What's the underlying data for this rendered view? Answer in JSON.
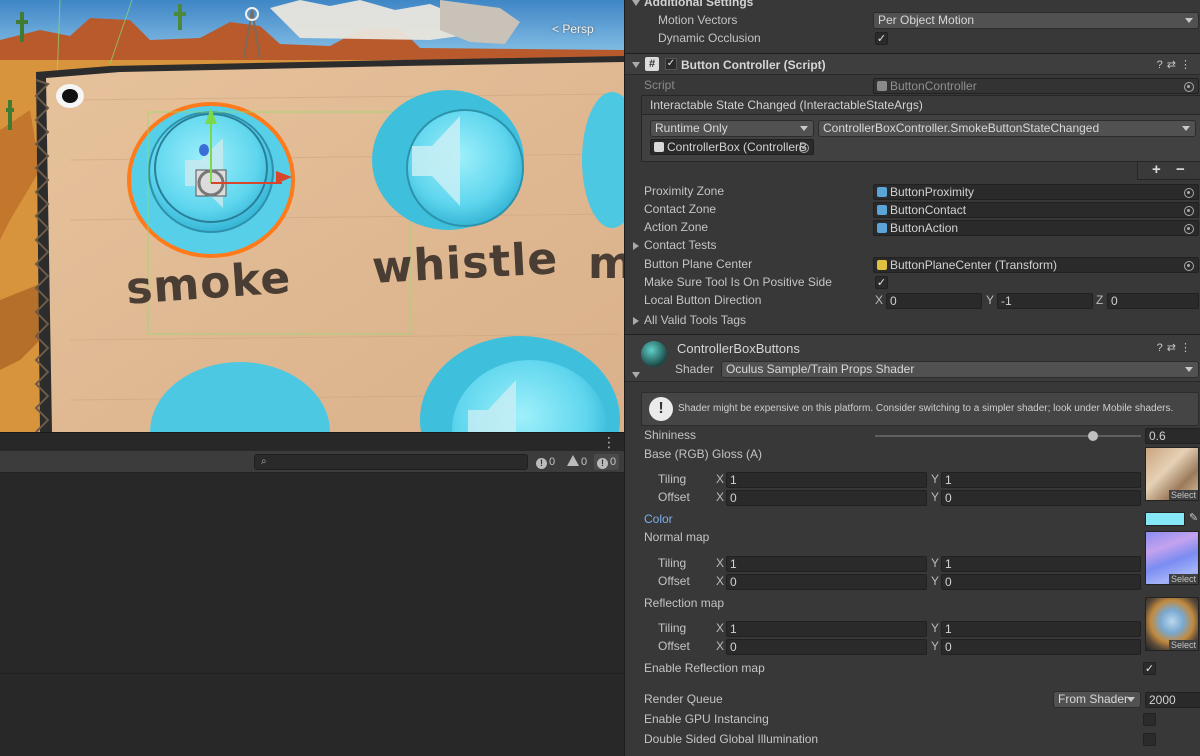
{
  "scene": {
    "persp_label": "< Persp",
    "labels": [
      "smoke",
      "whistle",
      "m"
    ]
  },
  "console": {
    "search_placeholder": "",
    "info_count": "0",
    "warning_count": "0",
    "error_count": "0"
  },
  "inspector": {
    "additional_settings": {
      "title": "Additional Settings",
      "motion_vectors_label": "Motion Vectors",
      "motion_vectors_value": "Per Object Motion",
      "dynamic_occlusion_label": "Dynamic Occlusion",
      "dynamic_occlusion_check": "✓"
    },
    "button_controller": {
      "title": "Button Controller (Script)",
      "script_label": "Script",
      "script_value": "ButtonController",
      "event_title": "Interactable State Changed (InteractableStateArgs)",
      "runtime_value": "Runtime Only",
      "function_value": "ControllerBoxController.SmokeButtonStateChanged",
      "target_value": "ControllerBox (ControllerB",
      "plus": "+",
      "minus": "−",
      "proximity_label": "Proximity Zone",
      "proximity_value": "ButtonProximity",
      "contact_label": "Contact Zone",
      "contact_value": "ButtonContact",
      "action_label": "Action Zone",
      "action_value": "ButtonAction",
      "contact_tests_label": "Contact Tests",
      "plane_center_label": "Button Plane Center",
      "plane_center_value": "ButtonPlaneCenter (Transform)",
      "positive_side_label": "Make Sure Tool Is On Positive Side",
      "positive_side_check": "✓",
      "direction_label": "Local Button Direction",
      "dir_x_label": "X",
      "dir_x": "0",
      "dir_y_label": "Y",
      "dir_y": "-1",
      "dir_z_label": "Z",
      "dir_z": "0",
      "valid_tags_label": "All Valid Tools Tags"
    },
    "material": {
      "title": "ControllerBoxButtons",
      "shader_label": "Shader",
      "shader_value": "Oculus Sample/Train Props Shader",
      "warning_text": "Shader might be expensive on this platform. Consider switching to a simpler shader; look under Mobile shaders.",
      "shininess_label": "Shininess",
      "shininess_value": "0.6",
      "shininess_fraction": 0.82,
      "base_label": "Base (RGB) Gloss (A)",
      "tiling_label": "Tiling",
      "offset_label": "Offset",
      "x_label": "X",
      "y_label": "Y",
      "base_tiling_x": "1",
      "base_tiling_y": "1",
      "base_offset_x": "0",
      "base_offset_y": "0",
      "color_label": "Color",
      "color_value": "#86e8f6",
      "normal_label": "Normal map",
      "normal_tiling_x": "1",
      "normal_tiling_y": "1",
      "normal_offset_x": "0",
      "normal_offset_y": "0",
      "reflection_label": "Reflection map",
      "refl_tiling_x": "1",
      "refl_tiling_y": "1",
      "refl_offset_x": "0",
      "refl_offset_y": "0",
      "select_label": "Select",
      "enable_refl_label": "Enable Reflection map",
      "enable_refl_check": "✓",
      "render_queue_label": "Render Queue",
      "render_queue_mode": "From Shader",
      "render_queue_value": "2000",
      "gpu_instancing_label": "Enable GPU Instancing",
      "double_sided_label": "Double Sided Global Illumination"
    }
  }
}
